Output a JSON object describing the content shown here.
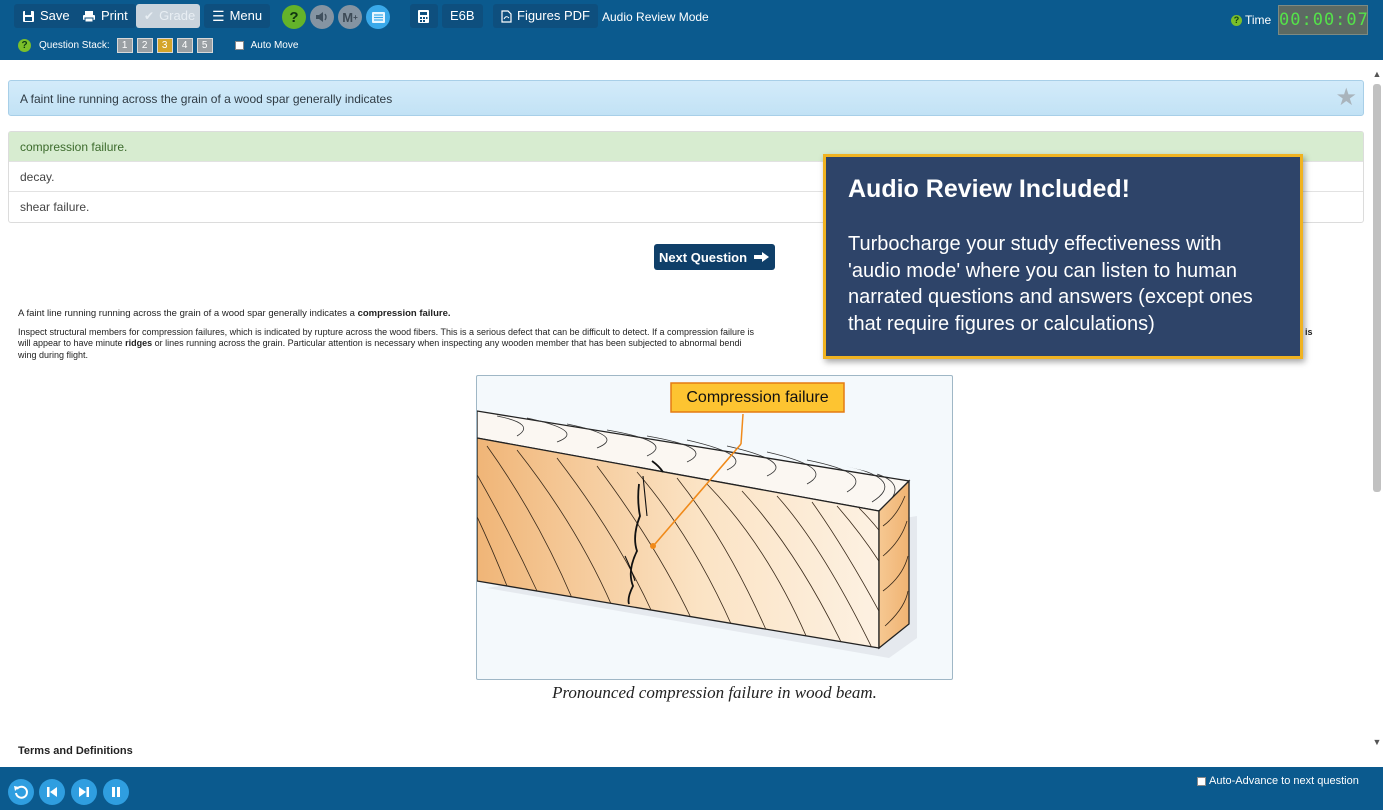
{
  "toolbar": {
    "save_label": "Save",
    "print_label": "Print",
    "grade_label": "Grade",
    "menu_label": "Menu",
    "help_glyph": "?",
    "markup_glyph": "M",
    "markup_superscript": "+",
    "e6b_label": "E6B",
    "figures_pdf_label": "Figures PDF",
    "mode_label": "Audio Review Mode"
  },
  "question_stack": {
    "label": "Question Stack:",
    "items": [
      "1",
      "2",
      "3",
      "4",
      "5"
    ],
    "active_index": 2,
    "auto_move_label": "Auto Move"
  },
  "timer": {
    "label": "Time",
    "value": "00:00:07"
  },
  "question": {
    "text": "A faint line running across the grain of a wood spar generally indicates"
  },
  "answers": [
    {
      "text": "compression failure.",
      "correct": true
    },
    {
      "text": "decay.",
      "correct": false
    },
    {
      "text": "shear failure.",
      "correct": false
    }
  ],
  "next_button_label": "Next Question",
  "explanation": {
    "summary_prefix": "A faint line running running across the grain of a wood spar generally indicates a",
    "summary_bold": "compression failure.",
    "detail_line1": "Inspect structural members for compression failures, which is indicated by rupture across the wood fibers. This is a serious defect that can be difficult to detect. If a compression failure is",
    "detail_line1_end": "is",
    "detail_line2_before": "will appear to have minute",
    "detail_line2_bold": "ridges",
    "detail_line2_after": "or lines running across the grain. Particular attention is necessary when inspecting any wooden member that has been subjected to abnormal bendi",
    "detail_line3": "wing during flight."
  },
  "figure": {
    "callout": "Compression failure",
    "caption": "Pronounced compression failure in wood beam."
  },
  "terms_heading": "Terms and Definitions",
  "promo": {
    "title": "Audio Review Included!",
    "body": "Turbocharge your study effectiveness with 'audio mode' where you can listen to human narrated  questions and answers (except ones that require figures or calculations)"
  },
  "bottom": {
    "auto_advance_label": "Auto-Advance to next question"
  },
  "colors": {
    "header_blue": "#0b5a8e",
    "correct_green": "#d7ecd0",
    "promo_navy": "#2e4469",
    "promo_border": "#f0b321",
    "callout_fill": "#fbc02d",
    "wood": "#f3c48d"
  }
}
